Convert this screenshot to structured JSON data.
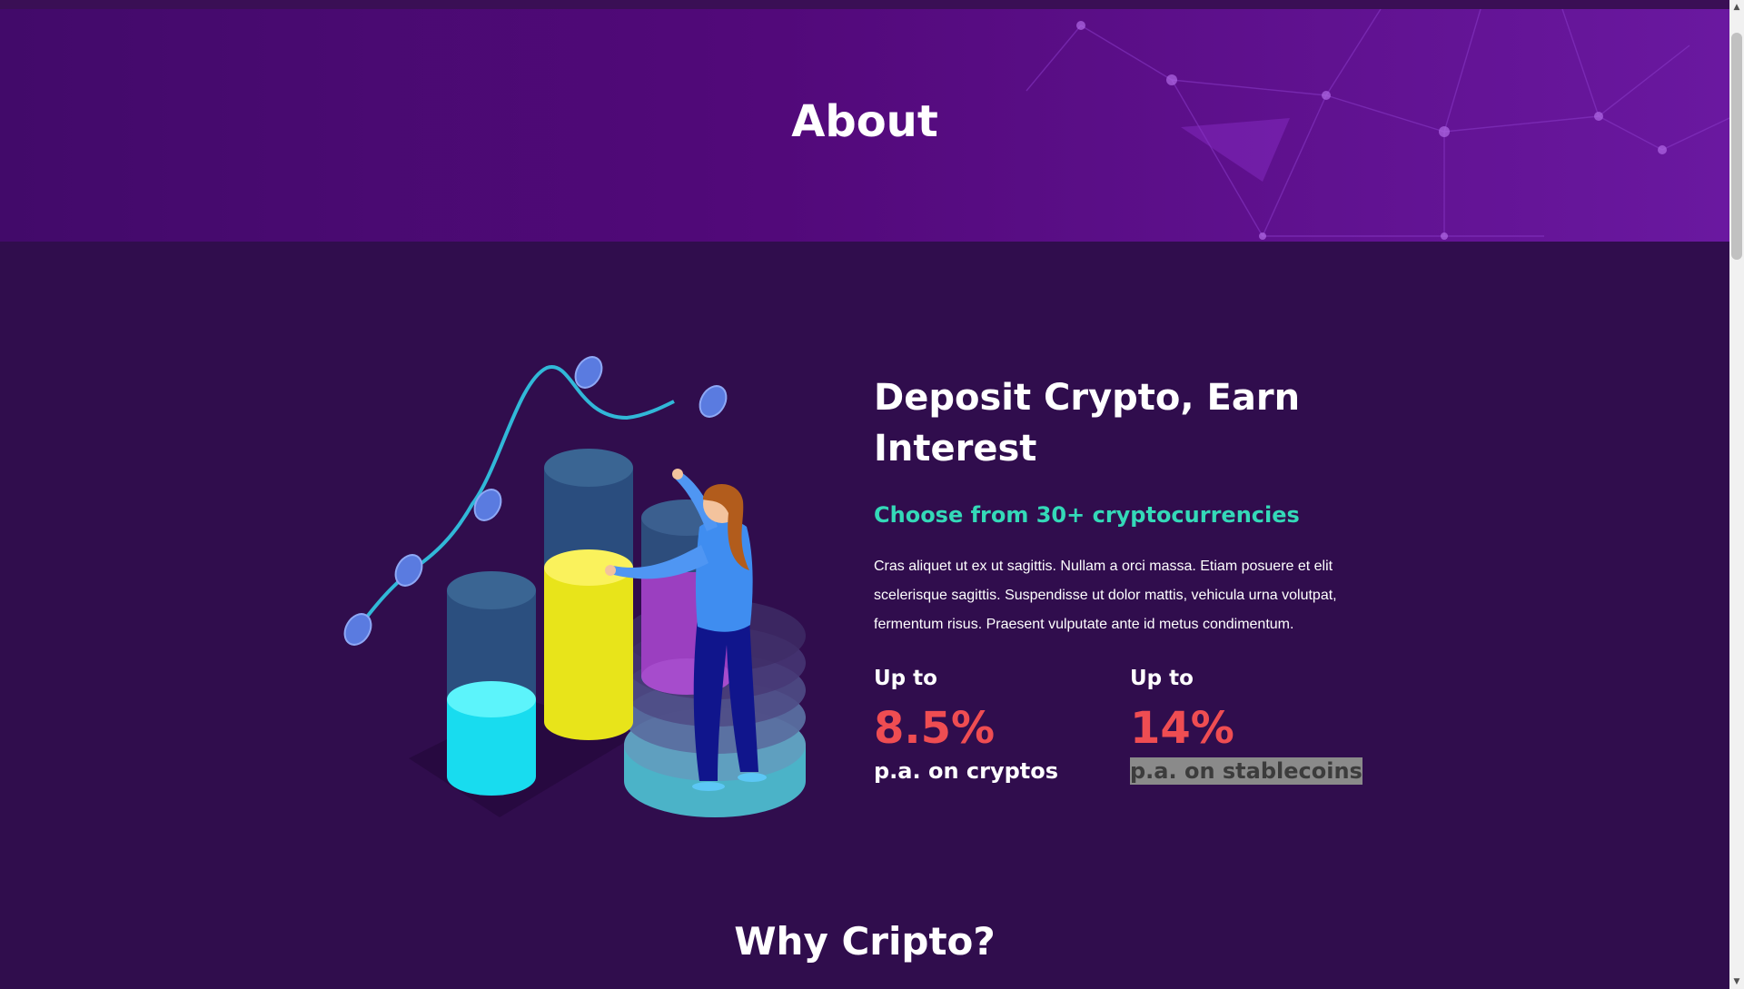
{
  "hero": {
    "title": "About"
  },
  "about": {
    "headline": "Deposit Crypto, Earn Interest",
    "subheadline": "Choose from 30+ cryptocurrencies",
    "body": "Cras aliquet ut ex ut sagittis. Nullam a orci massa. Etiam posuere et elit scelerisque sagittis. Suspendisse ut dolor mattis, vehicula urna volutpat, fermentum risus. Praesent vulputate ante id metus condimentum.",
    "stats": [
      {
        "prefix": "Up to",
        "value": "8.5%",
        "suffix": "p.a. on cryptos"
      },
      {
        "prefix": "Up to",
        "value": "14%",
        "suffix": "p.a. on stablecoins"
      }
    ]
  },
  "why": {
    "title": "Why Cripto?"
  },
  "scrollbar": {
    "up_arrow": "▲",
    "down_arrow": "▼"
  },
  "colors": {
    "background": "#300d4d",
    "hero": "#52097a",
    "accent_teal": "#34d9b8",
    "accent_red": "#ef4d52"
  }
}
